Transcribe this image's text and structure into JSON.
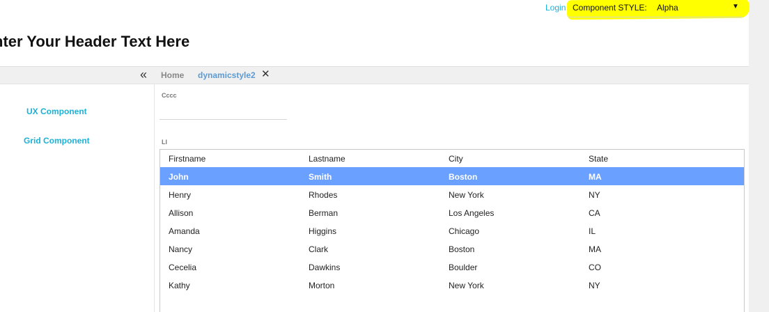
{
  "topbar": {
    "login_label": "Login",
    "style_label": "Component STYLE:",
    "style_value": "Alpha",
    "style_caret": "▼",
    "highlight_color": "#ffff00"
  },
  "page_title": "nter Your Header Text Here",
  "nav": {
    "collapse_icon": "«",
    "tabs": [
      {
        "label": "Home",
        "active": false
      },
      {
        "label": "dynamicstyle2",
        "active": true
      }
    ],
    "close_icon": "✕"
  },
  "sidebar": {
    "items": [
      {
        "label": "UX Component"
      },
      {
        "label": "Grid Component"
      }
    ]
  },
  "form": {
    "field_label": "Cccc",
    "field_value": ""
  },
  "grid": {
    "label": "Ll",
    "columns": [
      "Firstname",
      "Lastname",
      "City",
      "State"
    ],
    "rows": [
      [
        "John",
        "Smith",
        "Boston",
        "MA"
      ],
      [
        "Henry",
        "Rhodes",
        "New York",
        "NY"
      ],
      [
        "Allison",
        "Berman",
        "Los Angeles",
        "CA"
      ],
      [
        "Amanda",
        "Higgins",
        "Chicago",
        "IL"
      ],
      [
        "Nancy",
        "Clark",
        "Boston",
        "MA"
      ],
      [
        "Cecelia",
        "Dawkins",
        "Boulder",
        "CO"
      ],
      [
        "Kathy",
        "Morton",
        "New York",
        "NY"
      ]
    ],
    "selected_row": 0,
    "selected_color": "#6aa0ff"
  }
}
